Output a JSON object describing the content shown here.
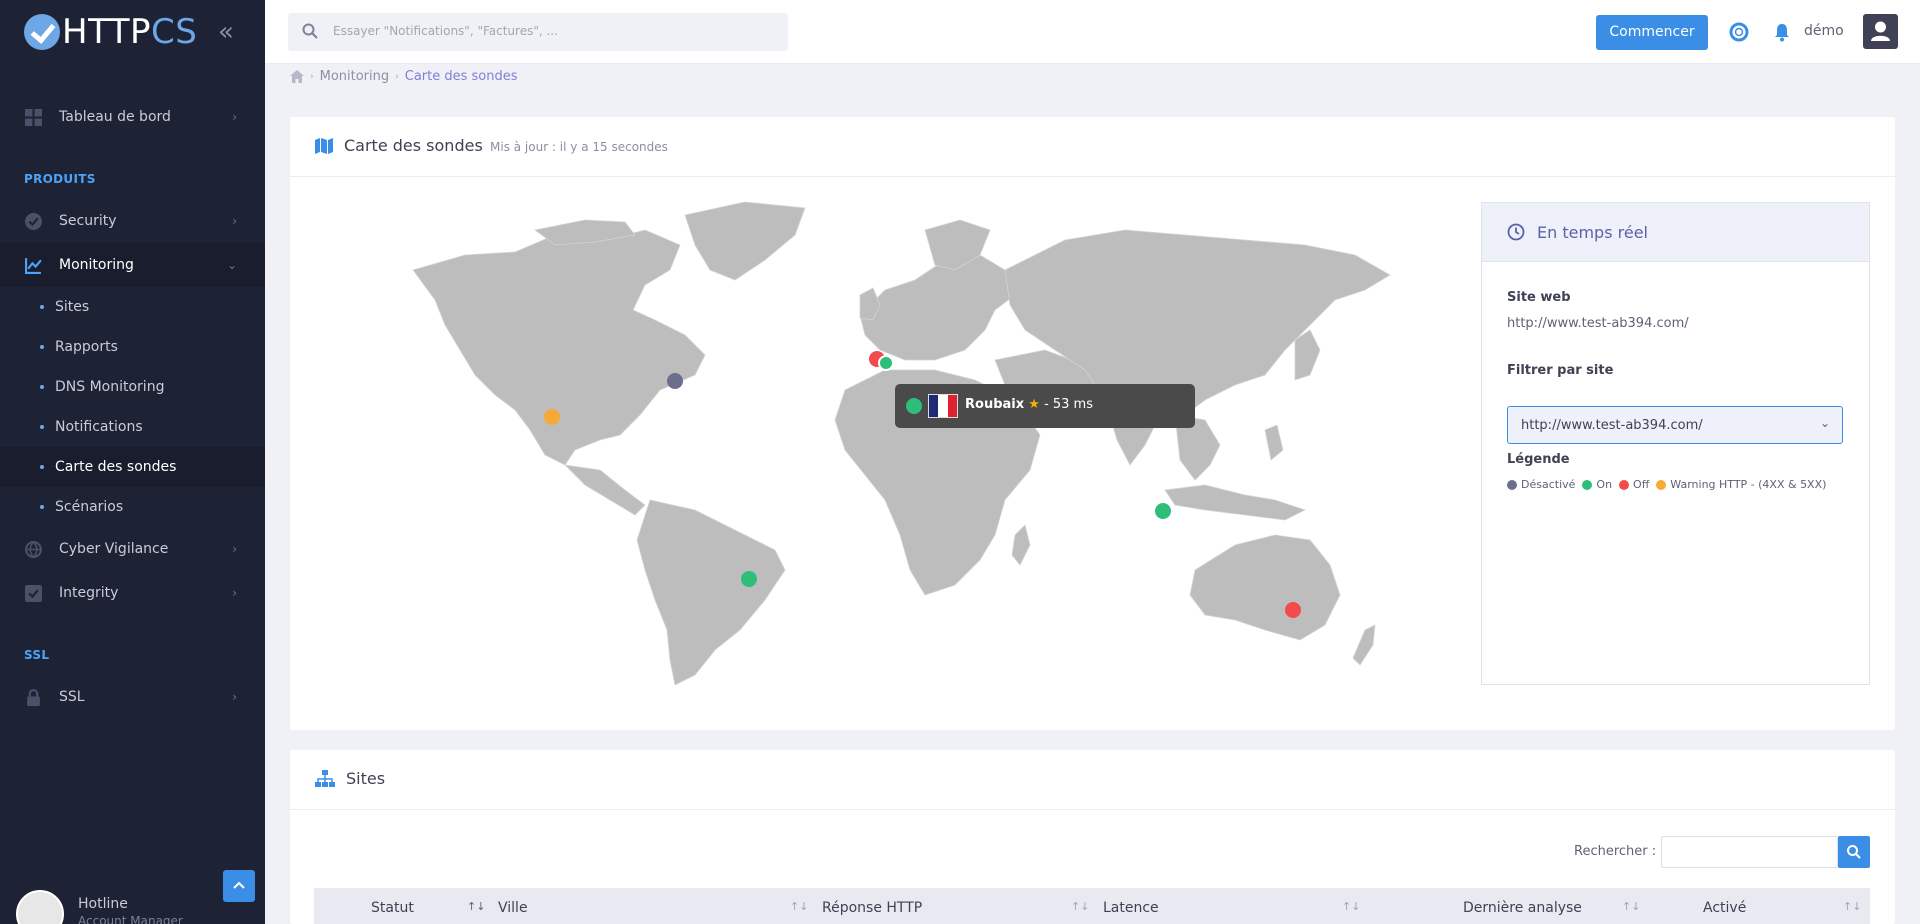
{
  "brand": {
    "name_part1": "HTTP",
    "name_part2": "CS"
  },
  "sidebar": {
    "dashboard": "Tableau de bord",
    "section_products": "PRODUITS",
    "security": "Security",
    "monitoring": "Monitoring",
    "monitoring_items": [
      "Sites",
      "Rapports",
      "DNS Monitoring",
      "Notifications",
      "Carte des sondes",
      "Scénarios"
    ],
    "cyber": "Cyber Vigilance",
    "integrity": "Integrity",
    "section_ssl": "SSL",
    "ssl": "SSL",
    "hotline_title": "Hotline",
    "hotline_sub": "Account Manager"
  },
  "header": {
    "search_placeholder": "Essayer \"Notifications\", \"Factures\", ...",
    "start_button": "Commencer",
    "user": "démo"
  },
  "breadcrumb": {
    "item1": "Monitoring",
    "current": "Carte des sondes"
  },
  "map_card": {
    "title": "Carte des sondes",
    "updated": "Mis à jour : il y a 15 secondes",
    "tooltip_city": "Roubaix",
    "tooltip_latency": "- 53 ms",
    "probe_colors": {
      "disabled": "#6b6f8c",
      "on": "#2dbe7a",
      "off": "#f24b4b",
      "warning": "#f7a936"
    }
  },
  "realtime": {
    "title": "En temps réel",
    "site_label": "Site web",
    "site_value": "http://www.test-ab394.com/",
    "filter_label": "Filtrer par site",
    "filter_value": "http://www.test-ab394.com/",
    "legend_label": "Légende",
    "legend": [
      {
        "label": "Désactivé",
        "color": "#6b6f8c"
      },
      {
        "label": "On",
        "color": "#2dbe7a"
      },
      {
        "label": "Off",
        "color": "#f24b4b"
      },
      {
        "label": "Warning HTTP - (4XX & 5XX)",
        "color": "#f7a936"
      }
    ]
  },
  "sites_card": {
    "title": "Sites",
    "search_label": "Rechercher :",
    "columns": [
      "Statut",
      "Ville",
      "Réponse HTTP",
      "Latence",
      "Dernière analyse",
      "Activé"
    ]
  }
}
